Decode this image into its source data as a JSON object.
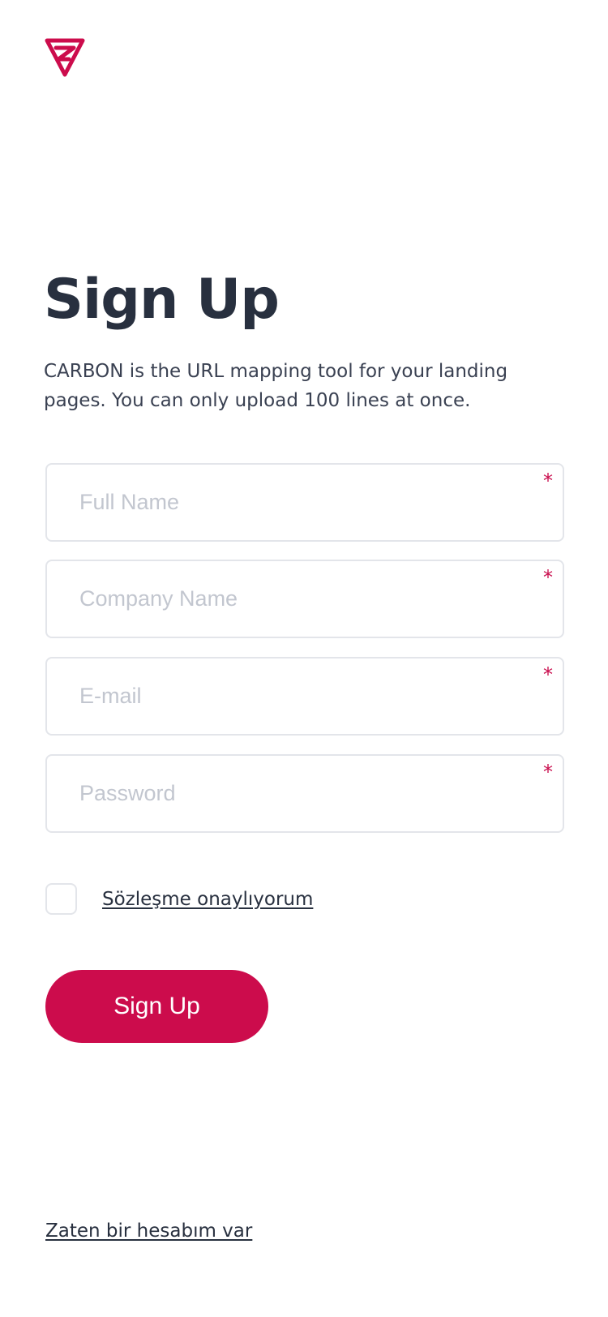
{
  "brand": {
    "logo_icon": "carbon-logo-icon",
    "accent_color": "#cc0c4c",
    "text_color": "#28303f"
  },
  "header": {
    "title": "Sign Up",
    "description": "CARBON is the URL mapping tool for your landing pages. You can only upload 100 lines at once."
  },
  "form": {
    "fields": [
      {
        "placeholder": "Full Name",
        "value": "",
        "required_mark": "*"
      },
      {
        "placeholder": "Company Name",
        "value": "",
        "required_mark": "*"
      },
      {
        "placeholder": "E-mail",
        "value": "",
        "required_mark": "*"
      },
      {
        "placeholder": "Password",
        "value": "",
        "required_mark": "*"
      }
    ],
    "agreement": {
      "checked": false,
      "label": "Sözleşme onaylıyorum"
    },
    "submit_label": "Sign Up"
  },
  "footer": {
    "login_link": "Zaten bir hesabım var"
  }
}
